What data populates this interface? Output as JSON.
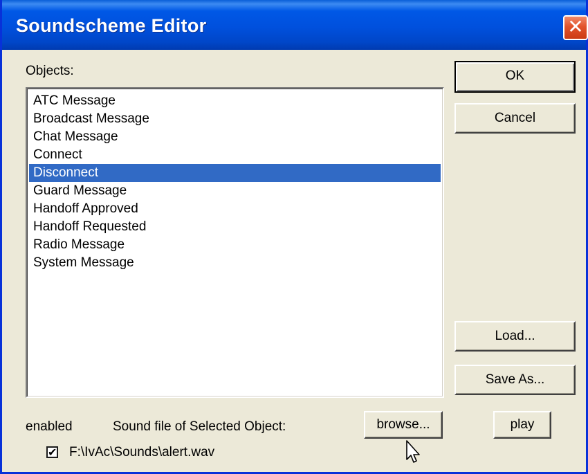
{
  "window": {
    "title": "Soundscheme Editor",
    "close_glyph": "✕"
  },
  "objects_label": "Objects:",
  "objects": [
    "ATC Message",
    "Broadcast Message",
    "Chat Message",
    "Connect",
    "Disconnect",
    "Guard Message",
    "Handoff Approved",
    "Handoff Requested",
    "Radio Message",
    "System Message"
  ],
  "selected_object": "Disconnect",
  "buttons": {
    "ok": "OK",
    "cancel": "Cancel",
    "load": "Load...",
    "save_as": "Save As...",
    "browse": "browse...",
    "play": "play"
  },
  "enabled_label": "enabled",
  "sound_file_label": "Sound file of Selected Object:",
  "enabled_checked": true,
  "check_glyph": "✔",
  "sound_file_path": "F:\\IvAc\\Sounds\\alert.wav",
  "colors": {
    "titlebar": "#0050dd",
    "selection": "#316ac5",
    "dialog_bg": "#ece9d8",
    "close_button": "#e2532b"
  },
  "icons": [
    "close-icon",
    "checkbox-check-icon",
    "mouse-pointer-icon"
  ]
}
